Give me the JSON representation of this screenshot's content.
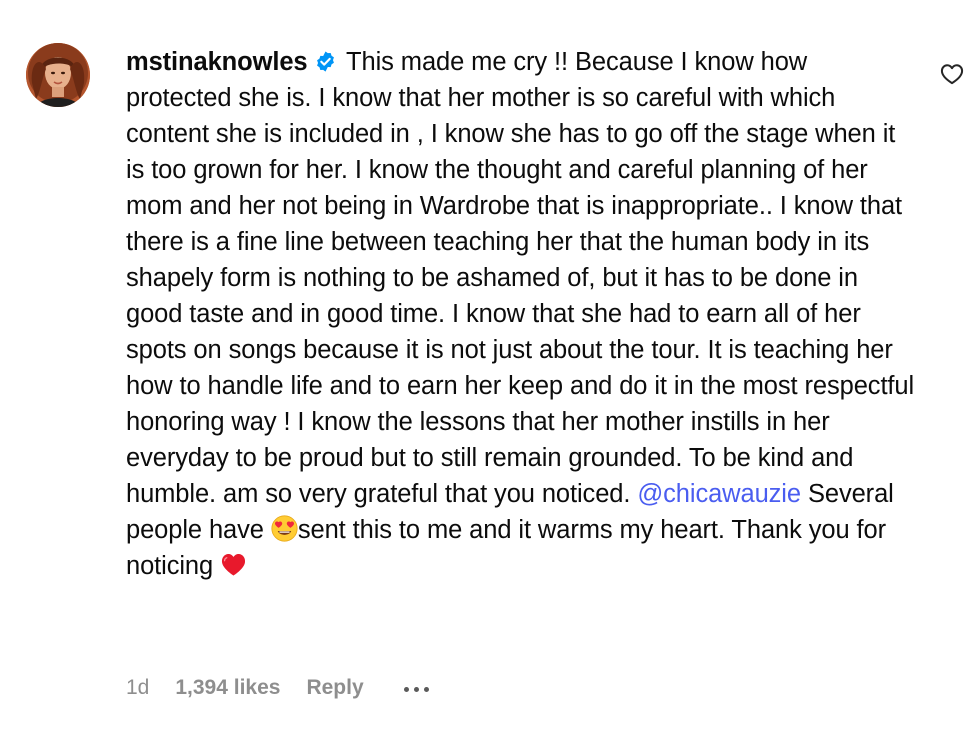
{
  "comment": {
    "username": "mstinaknowles",
    "text_before_emoji_parts": [
      "This made me cry !! Because I know how protected she is. I know that her mother is so careful with which content she is included in , I know she has to go off the stage when it is too grown for her. I know the thought and careful planning of her mom and her not being in Wardrobe that is inappropriate.. I know that there is a fine line between teaching her that the human body in its shapely form is nothing to be ashamed of, but it has to be done in good taste and in good time. I know that she had to earn all of her spots on songs because it is not just about the tour. It is teaching her how to handle life and to earn her keep and do it in the most respectful honoring way ! I know the lessons that her mother instills in her everyday to be proud but to still remain grounded. To be kind and humble. am so very grateful that you noticed.",
      "@chicawauzie",
      "Several people have",
      "sent this to me and it warms my heart. Thank you for noticing"
    ],
    "emojis": {
      "heart_eyes": "heart-eyes-emoji",
      "red_heart": "red-heart-emoji"
    }
  },
  "meta": {
    "time": "1d",
    "likes": "1,394 likes",
    "reply": "Reply"
  },
  "icons": {
    "verified": "verified-badge-icon",
    "like": "heart-outline-icon",
    "more": "more-options-icon"
  },
  "colors": {
    "mention": "#4a5df0",
    "verified": "#0095f6",
    "meta_text": "#8e8e8e"
  }
}
